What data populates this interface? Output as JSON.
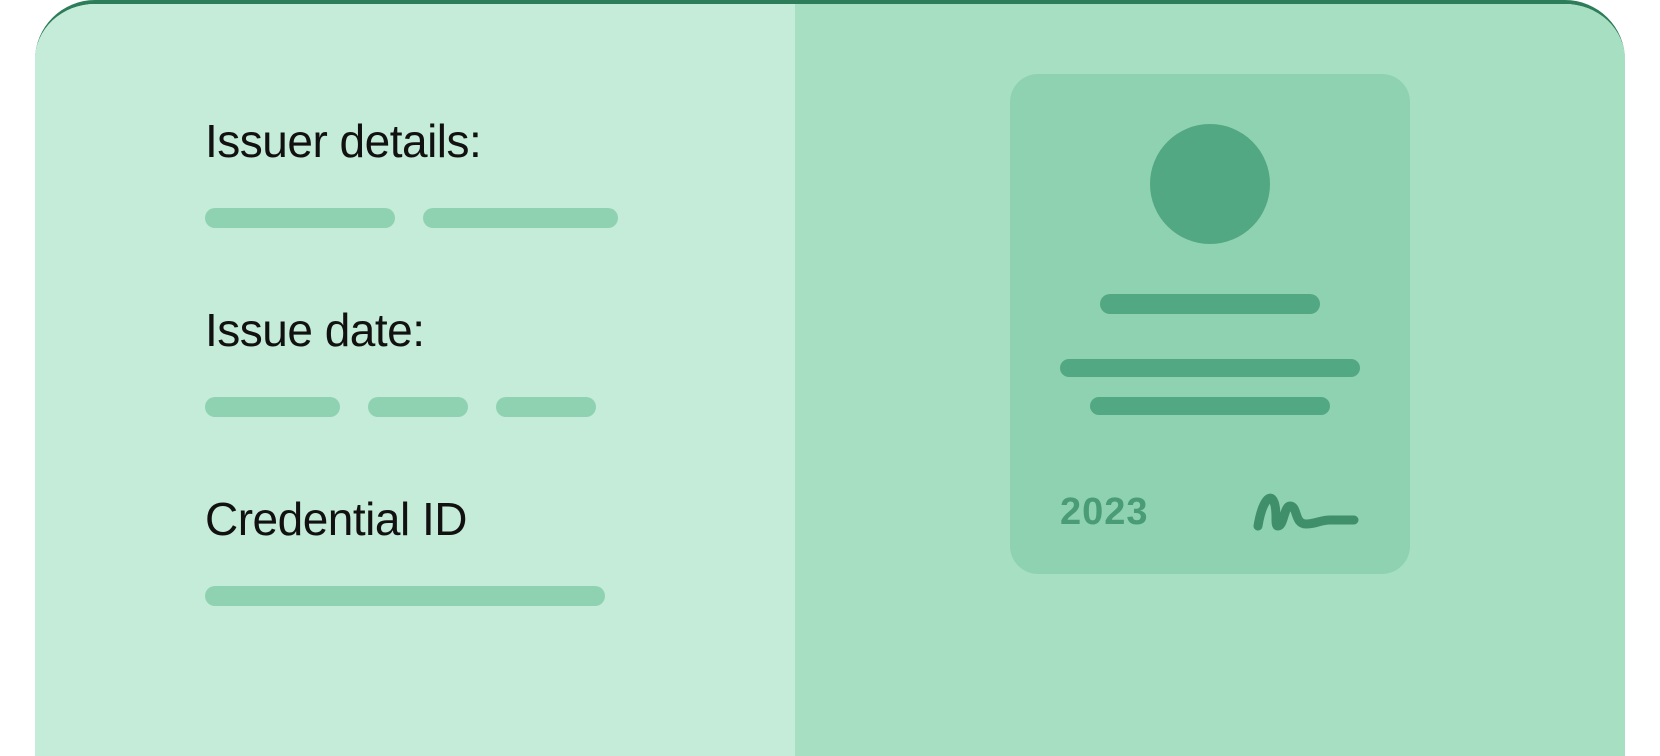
{
  "labels": {
    "issuer_details": "Issuer details:",
    "issue_date": "Issue date:",
    "credential_id": "Credential ID"
  },
  "certificate": {
    "year": "2023"
  }
}
